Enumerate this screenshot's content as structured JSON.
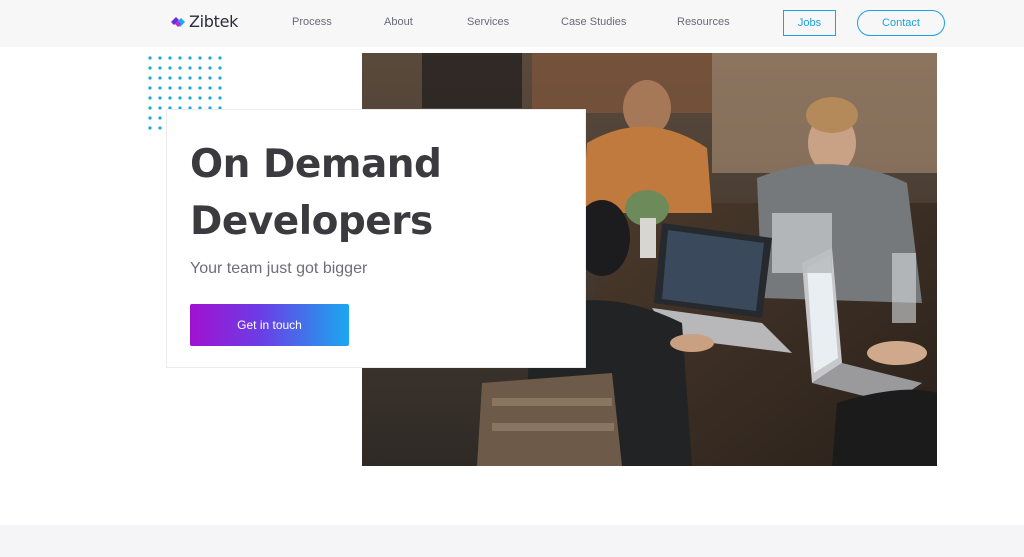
{
  "brand": {
    "name": "Zibtek"
  },
  "nav": {
    "items": [
      {
        "label": "Process"
      },
      {
        "label": "About"
      },
      {
        "label": "Services"
      },
      {
        "label": "Case Studies"
      },
      {
        "label": "Resources"
      }
    ],
    "jobs_label": "Jobs",
    "contact_label": "Contact"
  },
  "hero": {
    "title_line1": "On Demand",
    "title_line2": "Developers",
    "subtitle": "Your team just got bigger",
    "cta_label": "Get in touch",
    "image_alt": "developers-working-on-laptops-photo"
  },
  "colors": {
    "accent": "#1aa3dc",
    "cta_gradient_start": "#a012d0",
    "cta_gradient_end": "#1aa8f0",
    "dots": "#1aa8e0"
  }
}
